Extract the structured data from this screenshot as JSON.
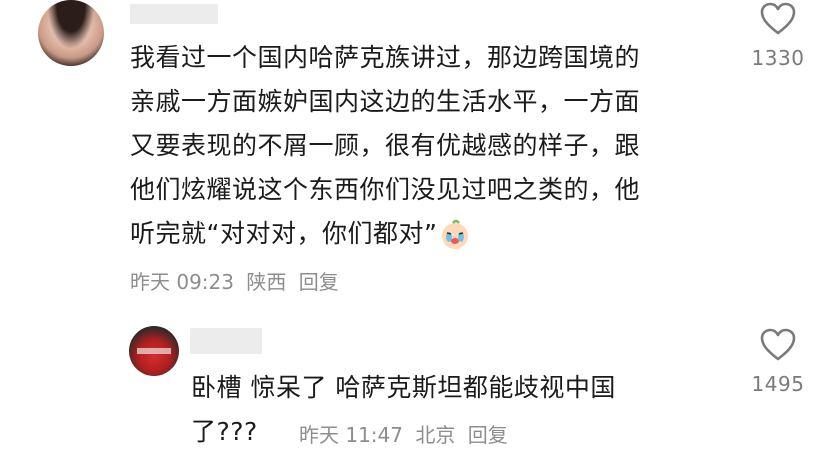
{
  "comments": [
    {
      "lines": [
        "我看过一个国内哈萨克族讲过，那边跨国境的",
        "亲戚一方面嫉妒国内这边的生活水平，一方面",
        "又要表现的不屑一顾，很有优越感的样子，跟",
        "他们炫耀说这个东西你们没见过吧之类的，他",
        "听完就“对对对，你们都对”"
      ],
      "time": "昨天 09:23",
      "location": "陕西",
      "reply": "回复",
      "likes": "1330"
    },
    {
      "lines": [
        "卧槽 惊呆了 哈萨克斯坦都能歧视中国",
        "了???"
      ],
      "time": "昨天 11:47",
      "location": "北京",
      "reply": "回复",
      "likes": "1495"
    }
  ],
  "icons": {
    "like": "heart-outline-icon",
    "emoji": "crying-face-emoji-icon"
  },
  "colors": {
    "text": "#1b1b1b",
    "meta": "#8d8d8d",
    "icon": "#7a7a7a"
  }
}
